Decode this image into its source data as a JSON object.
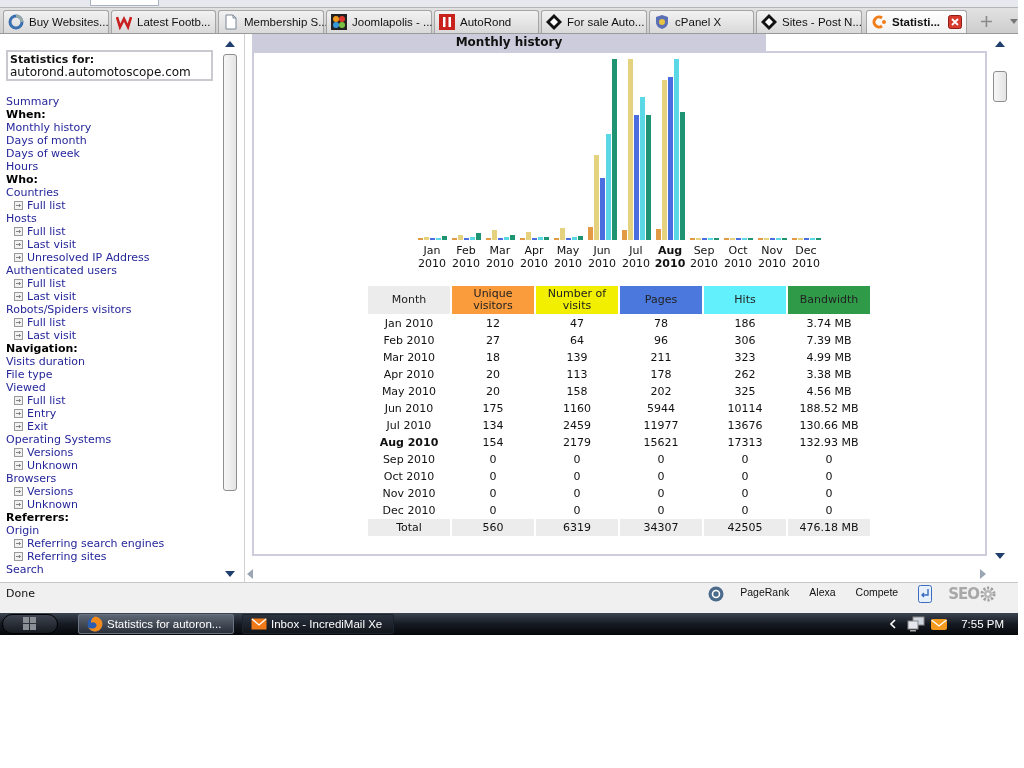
{
  "browser_tabs": [
    {
      "label": "Buy Websites...",
      "selected": false
    },
    {
      "label": "Latest Footb...",
      "selected": false
    },
    {
      "label": "Membership S...",
      "selected": false
    },
    {
      "label": "Joomlapolis - ...",
      "selected": false
    },
    {
      "label": "AutoRond",
      "selected": false
    },
    {
      "label": "For sale Auto...",
      "selected": false
    },
    {
      "label": "cPanel X",
      "selected": false
    },
    {
      "label": "Sites - Post N...",
      "selected": false
    },
    {
      "label": "Statisti...",
      "selected": true
    }
  ],
  "sidebar": {
    "stats_for": {
      "label": "Statistics for:",
      "domain": "autorond.automotoscope.com"
    },
    "items": [
      {
        "kind": "link",
        "label": "Summary"
      },
      {
        "kind": "heading",
        "label": "When:"
      },
      {
        "kind": "link",
        "label": "Monthly history"
      },
      {
        "kind": "link",
        "label": "Days of month"
      },
      {
        "kind": "link",
        "label": "Days of week"
      },
      {
        "kind": "link",
        "label": "Hours"
      },
      {
        "kind": "heading",
        "label": "Who:"
      },
      {
        "kind": "link",
        "label": "Countries",
        "children": [
          {
            "label": "Full list"
          }
        ]
      },
      {
        "kind": "link",
        "label": "Hosts",
        "children": [
          {
            "label": "Full list"
          },
          {
            "label": "Last visit"
          },
          {
            "label": "Unresolved IP Address"
          }
        ]
      },
      {
        "kind": "link",
        "label": "Authenticated users",
        "children": [
          {
            "label": "Full list"
          },
          {
            "label": "Last visit"
          }
        ]
      },
      {
        "kind": "link",
        "label": "Robots/Spiders visitors",
        "children": [
          {
            "label": "Full list"
          },
          {
            "label": "Last visit"
          }
        ]
      },
      {
        "kind": "heading",
        "label": "Navigation:"
      },
      {
        "kind": "link",
        "label": "Visits duration"
      },
      {
        "kind": "link",
        "label": "File type"
      },
      {
        "kind": "link",
        "label": "Viewed",
        "children": [
          {
            "label": "Full list"
          },
          {
            "label": "Entry"
          },
          {
            "label": "Exit"
          }
        ]
      },
      {
        "kind": "link",
        "label": "Operating Systems",
        "children": [
          {
            "label": "Versions"
          },
          {
            "label": "Unknown"
          }
        ]
      },
      {
        "kind": "link",
        "label": "Browsers",
        "children": [
          {
            "label": "Versions"
          },
          {
            "label": "Unknown"
          }
        ]
      },
      {
        "kind": "heading",
        "label": "Referrers:"
      },
      {
        "kind": "link",
        "label": "Origin",
        "children": [
          {
            "label": "Referring search engines"
          },
          {
            "label": "Referring sites"
          }
        ]
      },
      {
        "kind": "link",
        "label": "Search"
      }
    ]
  },
  "report": {
    "title": "Monthly history",
    "chart": {
      "series": [
        {
          "color": "#e29a44"
        },
        {
          "color": "#e5d27f"
        },
        {
          "color": "#4a6ee0"
        },
        {
          "color": "#5ad8e6"
        },
        {
          "color": "#1e9473"
        }
      ],
      "labels": [
        {
          "text": "Jan 2010",
          "current": false
        },
        {
          "text": "Feb 2010",
          "current": false
        },
        {
          "text": "Mar 2010",
          "current": false
        },
        {
          "text": "Apr 2010",
          "current": false
        },
        {
          "text": "May 2010",
          "current": false
        },
        {
          "text": "Jun 2010",
          "current": false
        },
        {
          "text": "Jul 2010",
          "current": false
        },
        {
          "text": "Aug 2010",
          "current": true
        },
        {
          "text": "Sep 2010",
          "current": false
        },
        {
          "text": "Oct 2010",
          "current": false
        },
        {
          "text": "Nov 2010",
          "current": false
        },
        {
          "text": "Dec 2010",
          "current": false
        }
      ]
    },
    "table": {
      "columns": [
        {
          "label": "Month",
          "color": "#ececec"
        },
        {
          "label": "Unique visitors",
          "color": "#fa9b3c"
        },
        {
          "label": "Number of visits",
          "color": "#f2f000"
        },
        {
          "label": "Pages",
          "color": "#4a78dc"
        },
        {
          "label": "Hits",
          "color": "#62f0fd"
        },
        {
          "label": "Bandwidth",
          "color": "#2f9a48"
        }
      ],
      "rows": [
        {
          "current": false,
          "cells": [
            "Jan 2010",
            "12",
            "47",
            "78",
            "186",
            "3.74 MB"
          ]
        },
        {
          "current": false,
          "cells": [
            "Feb 2010",
            "27",
            "64",
            "96",
            "306",
            "7.39 MB"
          ]
        },
        {
          "current": false,
          "cells": [
            "Mar 2010",
            "18",
            "139",
            "211",
            "323",
            "4.99 MB"
          ]
        },
        {
          "current": false,
          "cells": [
            "Apr 2010",
            "20",
            "113",
            "178",
            "262",
            "3.38 MB"
          ]
        },
        {
          "current": false,
          "cells": [
            "May 2010",
            "20",
            "158",
            "202",
            "325",
            "4.56 MB"
          ]
        },
        {
          "current": false,
          "cells": [
            "Jun 2010",
            "175",
            "1160",
            "5944",
            "10114",
            "188.52 MB"
          ]
        },
        {
          "current": false,
          "cells": [
            "Jul 2010",
            "134",
            "2459",
            "11977",
            "13676",
            "130.66 MB"
          ]
        },
        {
          "current": true,
          "cells": [
            "Aug 2010",
            "154",
            "2179",
            "15621",
            "17313",
            "132.93 MB"
          ]
        },
        {
          "current": false,
          "cells": [
            "Sep 2010",
            "0",
            "0",
            "0",
            "0",
            "0"
          ]
        },
        {
          "current": false,
          "cells": [
            "Oct 2010",
            "0",
            "0",
            "0",
            "0",
            "0"
          ]
        },
        {
          "current": false,
          "cells": [
            "Nov 2010",
            "0",
            "0",
            "0",
            "0",
            "0"
          ]
        },
        {
          "current": false,
          "cells": [
            "Dec 2010",
            "0",
            "0",
            "0",
            "0",
            "0"
          ]
        }
      ],
      "total": [
        "Total",
        "560",
        "6319",
        "34307",
        "42505",
        "476.18 MB"
      ]
    }
  },
  "status_bar": {
    "text": "Done",
    "tools": [
      "PageRank",
      "Alexa",
      "Compete"
    ],
    "logo": "SEO"
  },
  "taskbar": {
    "tasks": [
      {
        "label": "Statistics for autoron...",
        "selected": true
      },
      {
        "label": "Inbox - IncrediMail Xe",
        "selected": false
      }
    ],
    "clock": "7:55 PM"
  }
}
